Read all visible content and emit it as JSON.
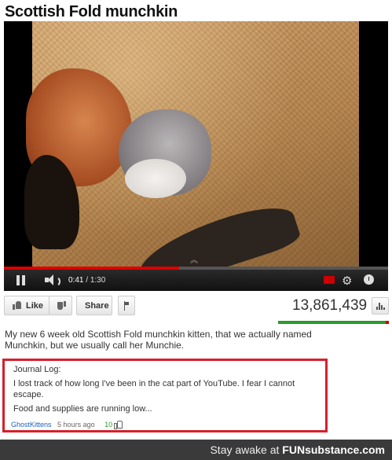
{
  "video": {
    "title": "Scottish Fold munchkin",
    "current_time": "0:41",
    "duration": "1:30",
    "time_separator": " / ",
    "progress_fraction": 0.4556
  },
  "actions": {
    "like_label": "Like",
    "share_label": "Share",
    "view_count": "13,861,439",
    "like_ratio": 0.97
  },
  "description": "My new 6 week old Scottish Fold munchkin kitten, that we actually named Munchkin, but we usually call her Munchie.",
  "comment": {
    "line1": "Journal Log:",
    "line2": "I lost track of how long I've been in the cat part of YouTube. I fear I cannot",
    "line3": "escape.",
    "line4": "Food and supplies are running low...",
    "author": "GhostKittens",
    "time": "5 hours ago",
    "votes": "10"
  },
  "footer": {
    "prefix": "Stay awake at ",
    "brand": "FUNsubstance.com"
  },
  "colors": {
    "comment_border": "#d61f2c",
    "like_bar_green": "#2b9b2b",
    "like_bar_red": "#cc0000",
    "author_blue": "#1a62bf"
  }
}
